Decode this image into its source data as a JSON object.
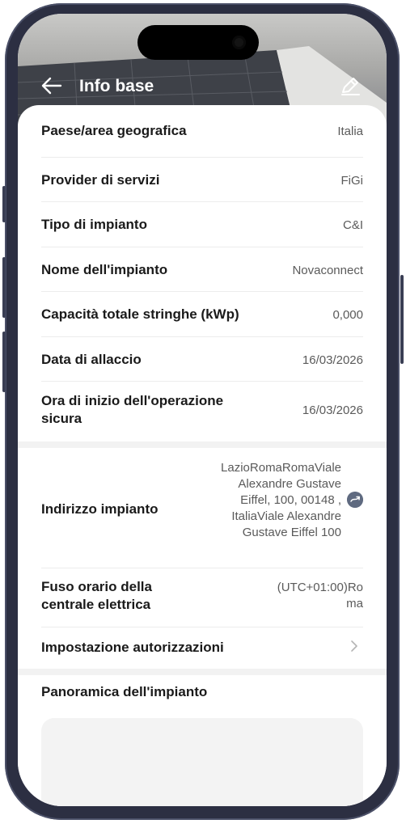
{
  "header": {
    "title": "Info base"
  },
  "rows": [
    {
      "label": "Paese/area geografica",
      "value": "Italia"
    },
    {
      "label": "Provider di servizi",
      "value": "FiGi"
    },
    {
      "label": "Tipo di impianto",
      "value": "C&I"
    },
    {
      "label": "Nome dell'impianto",
      "value": "Novaconnect"
    },
    {
      "label": "Capacità totale stringhe (kWp)",
      "value": "0,000"
    },
    {
      "label": "Data di allaccio",
      "value": "16/03/2026"
    },
    {
      "label_line1": "Ora di inizio dell'operazione",
      "label_line2": "sicura",
      "value": "16/03/2026"
    }
  ],
  "address": {
    "label": "Indirizzo impianto",
    "lines": [
      "LazioRomaRomaViale",
      "Alexandre Gustave",
      "Eiffel, 100, 00148  ,",
      "ItaliaViale Alexandre",
      "Gustave Eiffel 100"
    ]
  },
  "timezone": {
    "label_line1": "Fuso orario della",
    "label_line2": "centrale elettrica",
    "value_line1": "(UTC+01:00)Ro",
    "value_line2": "ma"
  },
  "permissions": {
    "label": "Impostazione autorizzazioni"
  },
  "overview": {
    "title": "Panoramica dell'impianto"
  }
}
